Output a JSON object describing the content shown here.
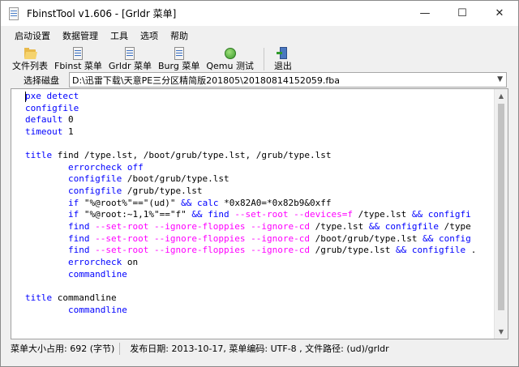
{
  "window": {
    "title": "FbinstTool v1.606 - [Grldr 菜单]",
    "controls": {
      "minimize": "—",
      "maximize": "☐",
      "close": "✕"
    }
  },
  "menu": [
    "启动设置",
    "数据管理",
    "工具",
    "选项",
    "帮助"
  ],
  "toolbar": [
    {
      "label": "文件列表",
      "icon": "folder-icon"
    },
    {
      "label": "Fbinst 菜单",
      "icon": "document-icon"
    },
    {
      "label": "Grldr 菜单",
      "icon": "document-icon"
    },
    {
      "label": "Burg 菜单",
      "icon": "document-icon"
    },
    {
      "label": "Qemu 测试",
      "icon": "qemu-icon"
    },
    {
      "label": "退出",
      "icon": "exit-icon"
    }
  ],
  "path": {
    "label": "选择磁盘",
    "value": "D:\\迅雷下载\\天意PE三分区精简版201805\\20180814152059.fba"
  },
  "code_lines": [
    [
      {
        "t": "pxe detect",
        "c": "kw"
      }
    ],
    [
      {
        "t": "configfile",
        "c": "kw"
      }
    ],
    [
      {
        "t": "default",
        "c": "kw"
      },
      {
        "t": " 0",
        "c": "txt"
      }
    ],
    [
      {
        "t": "timeout",
        "c": "kw"
      },
      {
        "t": " 1",
        "c": "txt"
      }
    ],
    [],
    [
      {
        "t": "title",
        "c": "kw"
      },
      {
        "t": " find /type.lst, /boot/grub/type.lst, /grub/type.lst",
        "c": "txt"
      }
    ],
    [
      {
        "t": "        ",
        "c": "txt"
      },
      {
        "t": "errorcheck off",
        "c": "kw"
      }
    ],
    [
      {
        "t": "        ",
        "c": "txt"
      },
      {
        "t": "configfile",
        "c": "kw"
      },
      {
        "t": " /boot/grub/type.lst",
        "c": "txt"
      }
    ],
    [
      {
        "t": "        ",
        "c": "txt"
      },
      {
        "t": "configfile",
        "c": "kw"
      },
      {
        "t": " /grub/type.lst",
        "c": "txt"
      }
    ],
    [
      {
        "t": "        ",
        "c": "txt"
      },
      {
        "t": "if",
        "c": "kw"
      },
      {
        "t": " \"%@root%\"==\"(ud)\" ",
        "c": "txt"
      },
      {
        "t": "&&",
        "c": "kw"
      },
      {
        "t": " ",
        "c": "txt"
      },
      {
        "t": "calc",
        "c": "kw"
      },
      {
        "t": " *0x82A0=*0x82b9&0xff",
        "c": "txt"
      }
    ],
    [
      {
        "t": "        ",
        "c": "txt"
      },
      {
        "t": "if",
        "c": "kw"
      },
      {
        "t": " \"%@root:~1,1%\"==\"f\" ",
        "c": "txt"
      },
      {
        "t": "&&",
        "c": "kw"
      },
      {
        "t": " ",
        "c": "txt"
      },
      {
        "t": "find",
        "c": "kw"
      },
      {
        "t": " ",
        "c": "txt"
      },
      {
        "t": "--set-root --devices=f",
        "c": "op"
      },
      {
        "t": " /type.lst ",
        "c": "txt"
      },
      {
        "t": "&&",
        "c": "kw"
      },
      {
        "t": " ",
        "c": "txt"
      },
      {
        "t": "configfi",
        "c": "kw"
      }
    ],
    [
      {
        "t": "        ",
        "c": "txt"
      },
      {
        "t": "find",
        "c": "kw"
      },
      {
        "t": " ",
        "c": "txt"
      },
      {
        "t": "--set-root --ignore-floppies --ignore-cd",
        "c": "op"
      },
      {
        "t": " /type.lst ",
        "c": "txt"
      },
      {
        "t": "&&",
        "c": "kw"
      },
      {
        "t": " ",
        "c": "txt"
      },
      {
        "t": "configfile",
        "c": "kw"
      },
      {
        "t": " /type",
        "c": "txt"
      }
    ],
    [
      {
        "t": "        ",
        "c": "txt"
      },
      {
        "t": "find",
        "c": "kw"
      },
      {
        "t": " ",
        "c": "txt"
      },
      {
        "t": "--set-root --ignore-floppies --ignore-cd",
        "c": "op"
      },
      {
        "t": " /boot/grub/type.lst ",
        "c": "txt"
      },
      {
        "t": "&&",
        "c": "kw"
      },
      {
        "t": " ",
        "c": "txt"
      },
      {
        "t": "config",
        "c": "kw"
      }
    ],
    [
      {
        "t": "        ",
        "c": "txt"
      },
      {
        "t": "find",
        "c": "kw"
      },
      {
        "t": " ",
        "c": "txt"
      },
      {
        "t": "--set-root --ignore-floppies --ignore-cd",
        "c": "op"
      },
      {
        "t": " /grub/type.lst ",
        "c": "txt"
      },
      {
        "t": "&&",
        "c": "kw"
      },
      {
        "t": " ",
        "c": "txt"
      },
      {
        "t": "configfile",
        "c": "kw"
      },
      {
        "t": " .",
        "c": "txt"
      }
    ],
    [
      {
        "t": "        ",
        "c": "txt"
      },
      {
        "t": "errorcheck",
        "c": "kw"
      },
      {
        "t": " on",
        "c": "txt"
      }
    ],
    [
      {
        "t": "        ",
        "c": "txt"
      },
      {
        "t": "commandline",
        "c": "kw"
      }
    ],
    [],
    [
      {
        "t": "title",
        "c": "kw"
      },
      {
        "t": " commandline",
        "c": "txt"
      }
    ],
    [
      {
        "t": "        ",
        "c": "txt"
      },
      {
        "t": "commandline",
        "c": "kw"
      }
    ]
  ],
  "status": {
    "size": "菜单大小占用: 692 (字节)",
    "info": "发布日期: 2013-10-17, 菜单编码: UTF-8 , 文件路径: (ud)/grldr"
  },
  "colors": {
    "keyword": "#0000ff",
    "option": "#ff00ff",
    "text": "#000000"
  }
}
